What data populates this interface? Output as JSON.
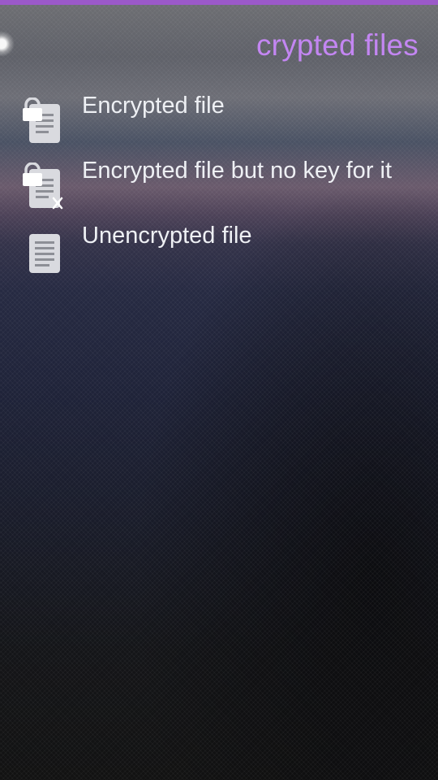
{
  "header": {
    "title": "crypted files"
  },
  "files": [
    {
      "label": "Encrypted file",
      "icon": "encrypted-file-icon"
    },
    {
      "label": "Encrypted file but no key for it",
      "icon": "encrypted-file-no-key-icon"
    },
    {
      "label": "Unencrypted file",
      "icon": "unencrypted-file-icon"
    }
  ],
  "colors": {
    "accent": "#9b59c9",
    "header_text": "#c386f2",
    "item_text": "#eef0f4",
    "icon_fill": "#d9dadf"
  }
}
